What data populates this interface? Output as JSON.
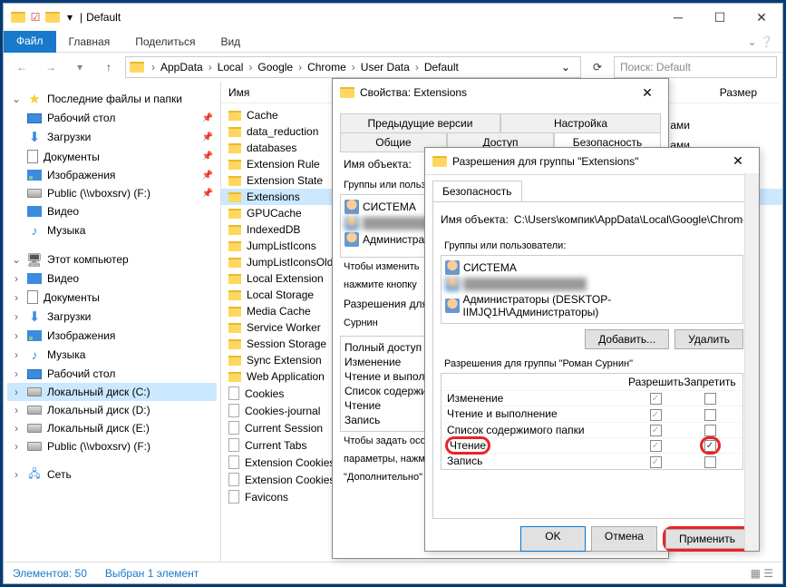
{
  "title": "Default",
  "ribbon": {
    "file": "Файл",
    "home": "Главная",
    "share": "Поделиться",
    "view": "Вид"
  },
  "breadcrumb": [
    "AppData",
    "Local",
    "Google",
    "Chrome",
    "User Data",
    "Default"
  ],
  "search_placeholder": "Поиск: Default",
  "columns": {
    "name": "Имя",
    "size": "Размер"
  },
  "nav": {
    "recent": "Последние файлы и папки",
    "desktop": "Рабочий стол",
    "downloads": "Загрузки",
    "documents": "Документы",
    "pictures": "Изображения",
    "public": "Public (\\\\vboxsrv) (F:)",
    "video": "Видео",
    "music": "Музыка",
    "thispc": "Этот компьютер",
    "localC": "Локальный диск (C:)",
    "localD": "Локальный диск (D:)",
    "localE": "Локальный диск (E:)",
    "network": "Сеть"
  },
  "files": {
    "folders": [
      "Cache",
      "data_reduction",
      "databases",
      "Extension Rule",
      "Extension State",
      "Extensions",
      "GPUCache",
      "IndexedDB",
      "JumpListIcons",
      "JumpListIconsOld",
      "Local Extension",
      "Local Storage",
      "Media Cache",
      "Service Worker",
      "Session Storage",
      "Sync Extension",
      "Web Application"
    ],
    "docs": [
      "Cookies",
      "Cookies-journal",
      "Current Session",
      "Current Tabs",
      "Extension Cookies",
      "Extension Cookies-journal",
      "Favicons"
    ]
  },
  "status": {
    "items": "Элементов: 50",
    "selected": "Выбран 1 элемент"
  },
  "dlg1": {
    "title": "Свойства: Extensions",
    "tabs": {
      "prev": "Предыдущие версии",
      "settings": "Настройка",
      "general": "Общие",
      "access": "Доступ",
      "security": "Безопасность"
    },
    "object_label": "Имя объекта:",
    "groups_label": "Группы или пользователи",
    "users": [
      "СИСТЕМА",
      "",
      "Администраторы"
    ],
    "note1": "Чтобы изменить",
    "note2": "нажмите кнопку",
    "perm_label": "Разрешения для",
    "perm_user": "Сурнин",
    "perms": [
      "Полный доступ",
      "Изменение",
      "Чтение и выполнение",
      "Список содержимого",
      "Чтение",
      "Запись"
    ],
    "note3": "Чтобы задать особые",
    "note4": "параметры, нажмите",
    "note5": "\"Дополнительно\"",
    "side_text": "ами"
  },
  "dlg2": {
    "title": "Разрешения для группы \"Extensions\"",
    "tab": "Безопасность",
    "object_label": "Имя объекта:",
    "object_path": "C:\\Users\\компик\\AppData\\Local\\Google\\Chrome",
    "groups_label": "Группы или пользователи:",
    "users": {
      "system": "СИСТЕМА",
      "blurred": "",
      "admins": "Администраторы (DESKTOP-IIMJQ1H\\Администраторы)"
    },
    "add": "Добавить...",
    "remove": "Удалить",
    "perm_label": "Разрешения для группы \"Роман Сурнин\"",
    "allow": "Разрешить",
    "deny": "Запретить",
    "perms": [
      "Изменение",
      "Чтение и выполнение",
      "Список содержимого папки",
      "Чтение",
      "Запись"
    ],
    "ok": "OK",
    "cancel": "Отмена",
    "apply": "Применить"
  }
}
